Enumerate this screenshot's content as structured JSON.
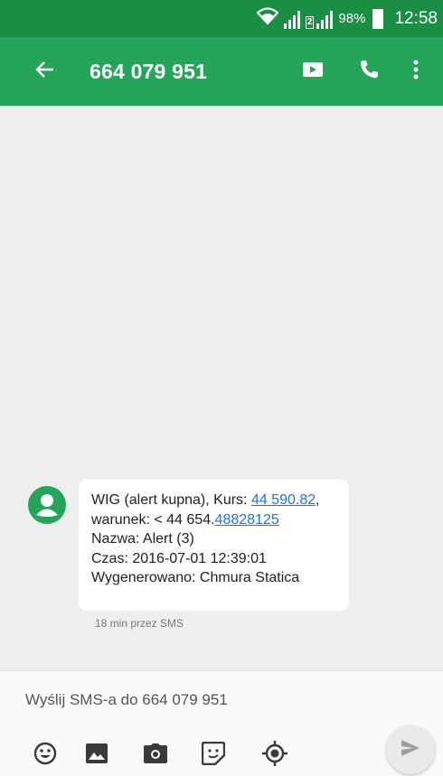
{
  "status_bar": {
    "sim2_badge": "2",
    "battery_percent": "98%",
    "time": "12:58",
    "icons": [
      "wifi-icon",
      "signal-sim1-icon",
      "signal-sim2-icon",
      "battery-icon"
    ]
  },
  "app_bar": {
    "title": "664 079 951",
    "icons": [
      "back-arrow-icon",
      "video-call-icon",
      "phone-icon",
      "more-vert-icon"
    ]
  },
  "message": {
    "line1_prefix": "WIG (alert kupna), Kurs: ",
    "line1_link": "44 590.82",
    "line1_suffix": ",",
    "line2_prefix": "warunek: < 44 654.",
    "line2_link": "48828125",
    "line3": "Nazwa: Alert (3)",
    "line4": "Czas: 2016-07-01 12:39:01",
    "line5": "Wygenerowano: Chmura Statica",
    "meta": "18 min przez SMS",
    "avatar_icon": "person-icon"
  },
  "compose": {
    "placeholder": "Wyślij SMS-a do 664 079 951",
    "tools": [
      "emoji-icon",
      "image-icon",
      "camera-icon",
      "sticker-icon",
      "location-icon"
    ],
    "send_icon": "send-icon"
  },
  "colors": {
    "status_bar": "#1a8f44",
    "app_bar": "#25a55a",
    "background": "#eeeeee",
    "link": "#1a73e8"
  }
}
